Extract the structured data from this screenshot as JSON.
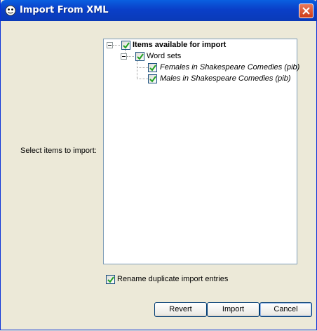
{
  "window": {
    "title": "Import From XML"
  },
  "form": {
    "select_label": "Select items to import:"
  },
  "tree": {
    "root": {
      "label": "Items available for import",
      "checked": true
    },
    "group": {
      "label": "Word sets",
      "checked": true
    },
    "items": [
      {
        "label": "Females in Shakespeare Comedies (pib)",
        "checked": true
      },
      {
        "label": "Males in Shakespeare Comedies (pib)",
        "checked": true
      }
    ]
  },
  "options": {
    "rename_label": "Rename duplicate import entries",
    "rename_checked": true
  },
  "buttons": {
    "revert": "Revert",
    "import": "Import",
    "cancel": "Cancel"
  }
}
